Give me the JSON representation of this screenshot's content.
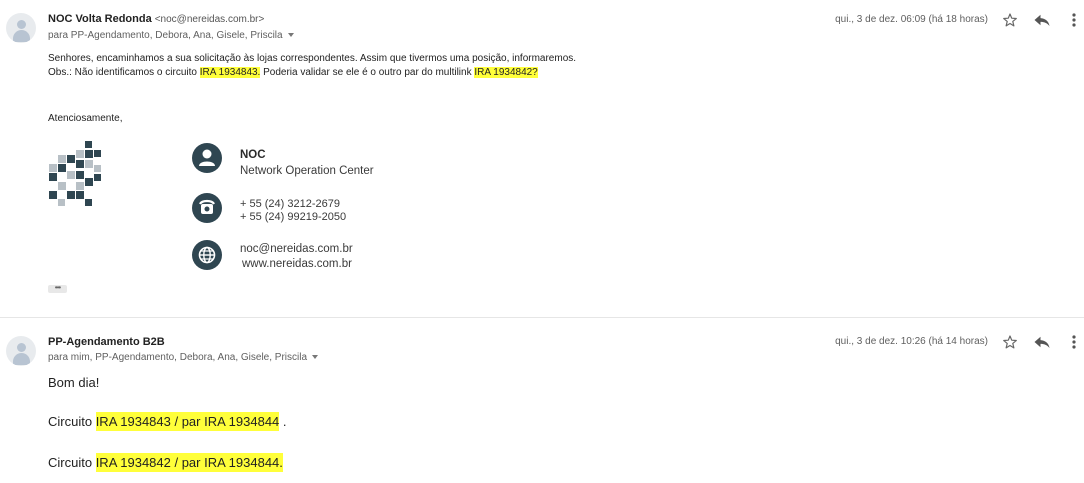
{
  "message1": {
    "sender_name": "NOC Volta Redonda",
    "sender_email": "<noc@nereidas.com.br>",
    "recipients": "para PP-Agendamento, Debora, Ana, Gisele, Priscila",
    "date": "qui., 3 de dez. 06:09 (há 18 horas)",
    "body_line1": "Senhores, encaminhamos a sua solicitação às lojas correspondentes. Assim que tivermos uma posição, informaremos.",
    "body_line2_a": "Obs.: Não identificamos o circuito ",
    "body_line2_hl1": "IRA 1934843.",
    "body_line2_b": " Poderia validar se ele é o outro par do multilink ",
    "body_line2_hl2": "IRA 1934842?",
    "closing": "Atenciosamente,",
    "signature": {
      "title": "NOC",
      "subtitle": "Network Operation Center",
      "phone1": "+ 55 (24) 3212-2679",
      "phone2": "+ 55 (24) 99219-2050",
      "email": "noc@nereidas.com.br",
      "website": "www.nereidas.com.br"
    },
    "more_label": "•••"
  },
  "message2": {
    "sender_name": "PP-Agendamento B2B",
    "recipients": "para mim, PP-Agendamento, Debora, Ana, Gisele, Priscila",
    "date": "qui., 3 de dez. 10:26 (há 14 horas)",
    "greeting": "Bom dia!",
    "line1_prefix": "Circuito ",
    "line1_hl": "IRA 1934843 / par  IRA 1934844",
    "line1_suffix": " .",
    "line2_prefix": "Circuito ",
    "line2_hl": "IRA 1934842 /  par IRA  1934844."
  },
  "colors": {
    "highlight": "#ffff3a",
    "signature_icon_bg": "#2f4651",
    "logo_dark": "#2f4651",
    "logo_light": "#b8c0c6"
  },
  "icons": [
    "person-icon",
    "star-icon",
    "reply-icon",
    "more-vert-icon",
    "phone-icon",
    "globe-icon",
    "caret-down-icon"
  ]
}
